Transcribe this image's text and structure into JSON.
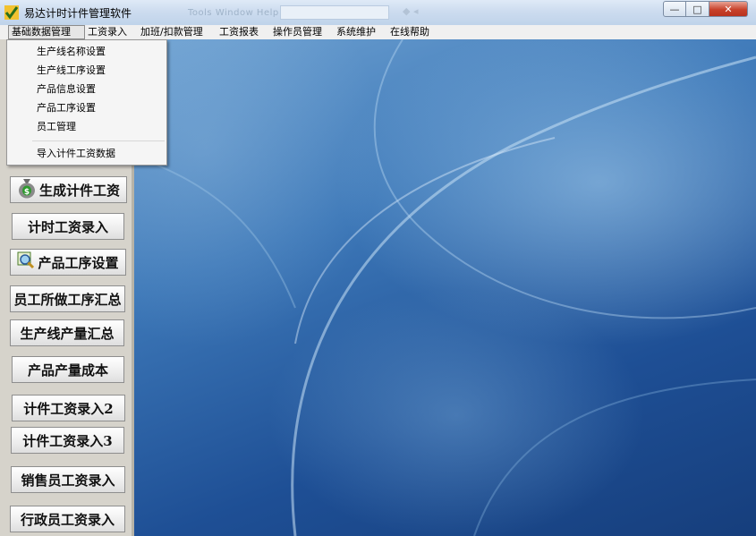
{
  "window": {
    "title": "易达计时计件管理软件",
    "ghost_menu": "Tools  Window  Help",
    "buttons": {
      "minimize": "—",
      "maximize": "□",
      "close": "✕"
    }
  },
  "menubar": {
    "items": [
      "基础数据管理",
      "工资录入",
      "加班/扣款管理",
      "工资报表",
      "操作员管理",
      "系统维护",
      "在线帮助"
    ]
  },
  "dropdown": {
    "items": [
      "生产线名称设置",
      "生产线工序设置",
      "产品信息设置",
      "产品工序设置",
      "员工管理",
      "导入计件工资数据"
    ]
  },
  "sidebar": {
    "buttons": [
      {
        "label": "生成计件工资",
        "icon": "money-bag-icon"
      },
      {
        "label": "计时工资录入"
      },
      {
        "label": "产品工序设置",
        "icon": "magnifier-icon"
      },
      {
        "label": "员工所做工序汇总"
      },
      {
        "label": "生产线产量汇总"
      },
      {
        "label": "产品产量成本"
      },
      {
        "label": "计件工资录入2"
      },
      {
        "label": "计件工资录入3"
      },
      {
        "label": "销售员工资录入"
      },
      {
        "label": "行政员工资录入"
      }
    ]
  },
  "colors": {
    "accent": "#1e4f95",
    "menu_bg": "#f0f0f0",
    "sidebar_bg": "#d6d3cb"
  }
}
